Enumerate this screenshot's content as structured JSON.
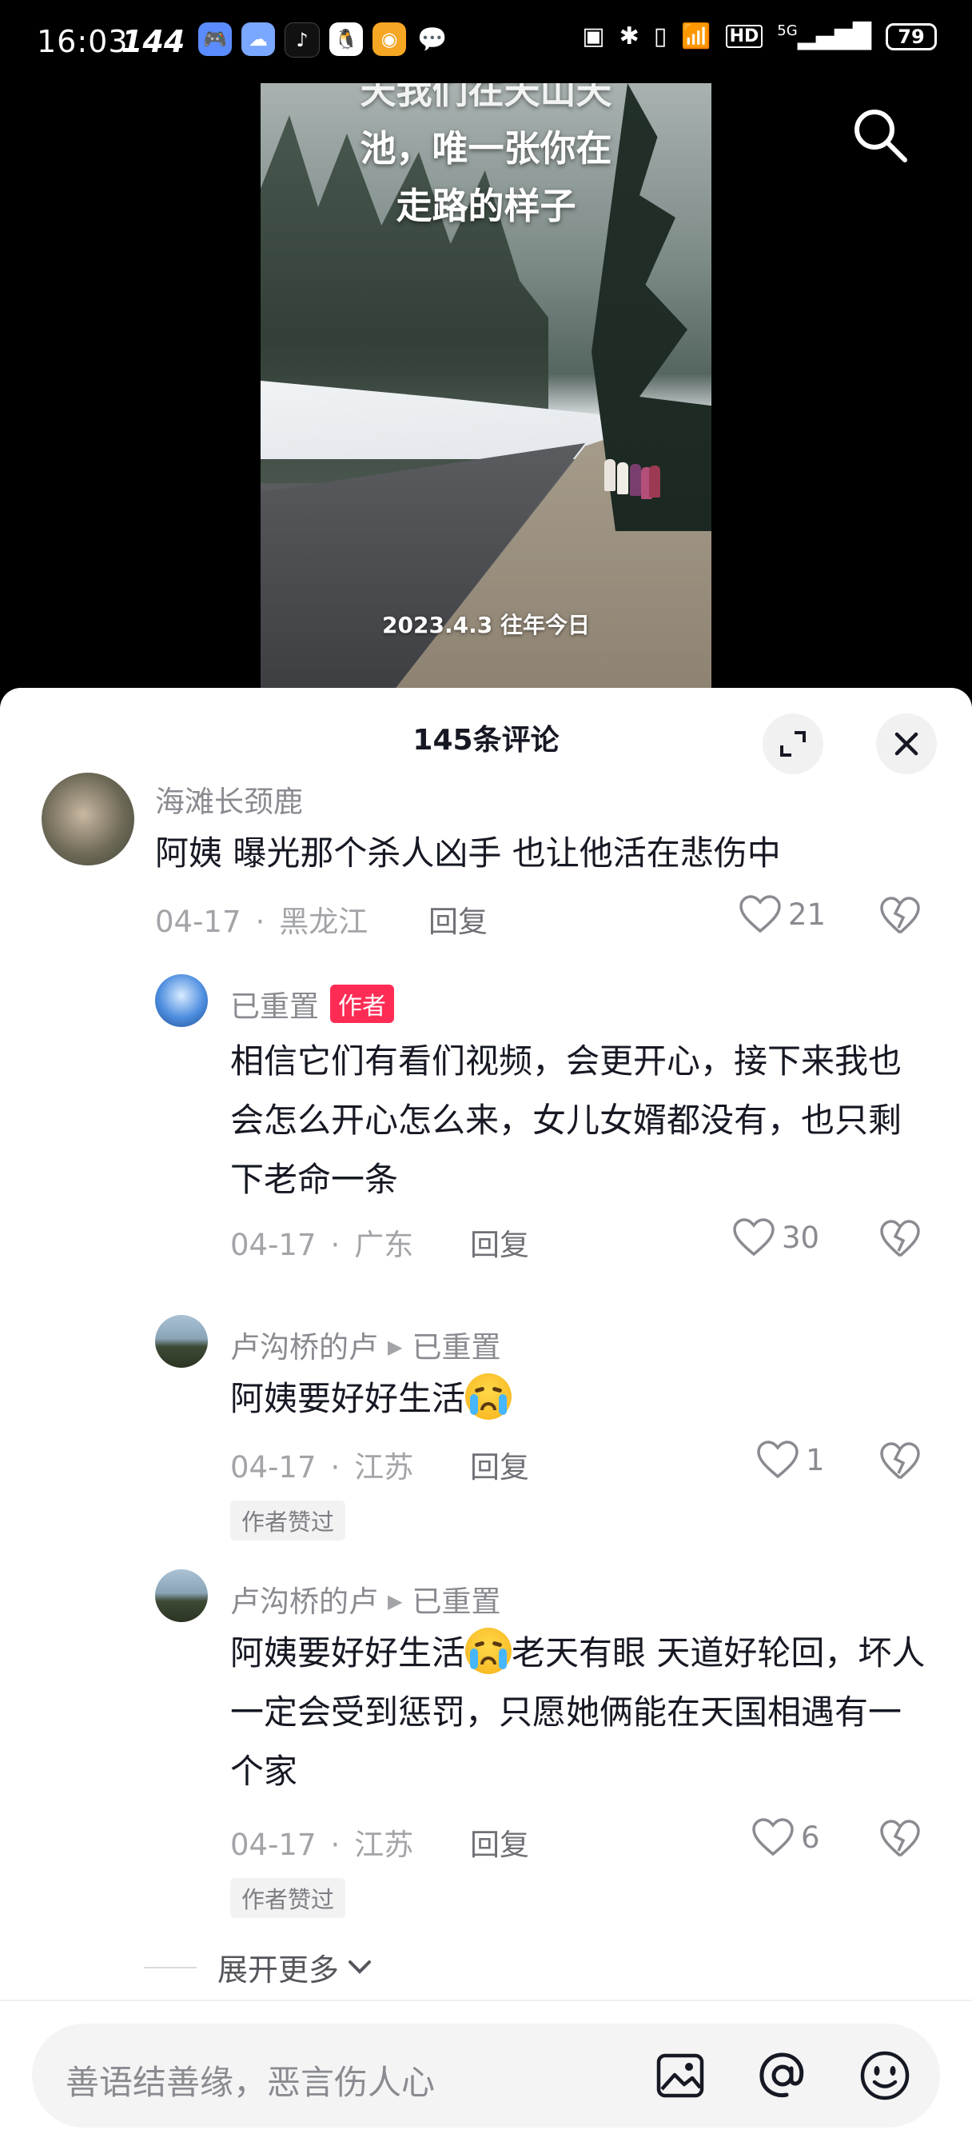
{
  "status_bar": {
    "time": "16:03",
    "refresh_rate": "144",
    "battery": "79",
    "network": "5G",
    "apps": [
      "game-center-icon",
      "cloud-app-icon",
      "tiktok-icon",
      "qq-icon",
      "weibo-icon",
      "chat-bubble-icon"
    ]
  },
  "video": {
    "caption_lines": [
      "天我们在天山天",
      "池，唯一张你在",
      "走路的样子"
    ],
    "date_overlay": "2023.4.3 往年今日"
  },
  "comments_header": {
    "title": "145条评论"
  },
  "comments": [
    {
      "user": "海滩长颈鹿",
      "text": "阿姨 曝光那个杀人凶手 也让他活在悲伤中",
      "date": "04-17",
      "location": "黑龙江",
      "reply_label": "回复",
      "likes": "21"
    },
    {
      "user": "已重置",
      "badge": "作者",
      "text": "相信它们有看们视频，会更开心，接下来我也会怎么开心怎么来，女儿女婿都没有，也只剩下老命一条",
      "date": "04-17",
      "location": "广东",
      "reply_label": "回复",
      "likes": "30"
    },
    {
      "user": "卢沟桥的卢",
      "reply_to": "已重置",
      "text": "阿姨要好好生活",
      "date": "04-17",
      "location": "江苏",
      "reply_label": "回复",
      "likes": "1",
      "author_liked": "作者赞过"
    },
    {
      "user": "卢沟桥的卢",
      "reply_to": "已重置",
      "text_before_emoji": "阿姨要好好生活",
      "text_after_emoji": "老天有眼 天道好轮回，坏人一定会受到惩罚，只愿她俩能在天国相遇有一个家",
      "date": "04-17",
      "location": "江苏",
      "reply_label": "回复",
      "likes": "6",
      "author_liked": "作者赞过"
    }
  ],
  "expand_more": "展开更多",
  "input": {
    "placeholder": "善语结善缘，恶言伤人心"
  },
  "colors": {
    "author_badge": "#fe2c55",
    "text_primary": "#161823",
    "text_secondary": "#8a8b91"
  }
}
